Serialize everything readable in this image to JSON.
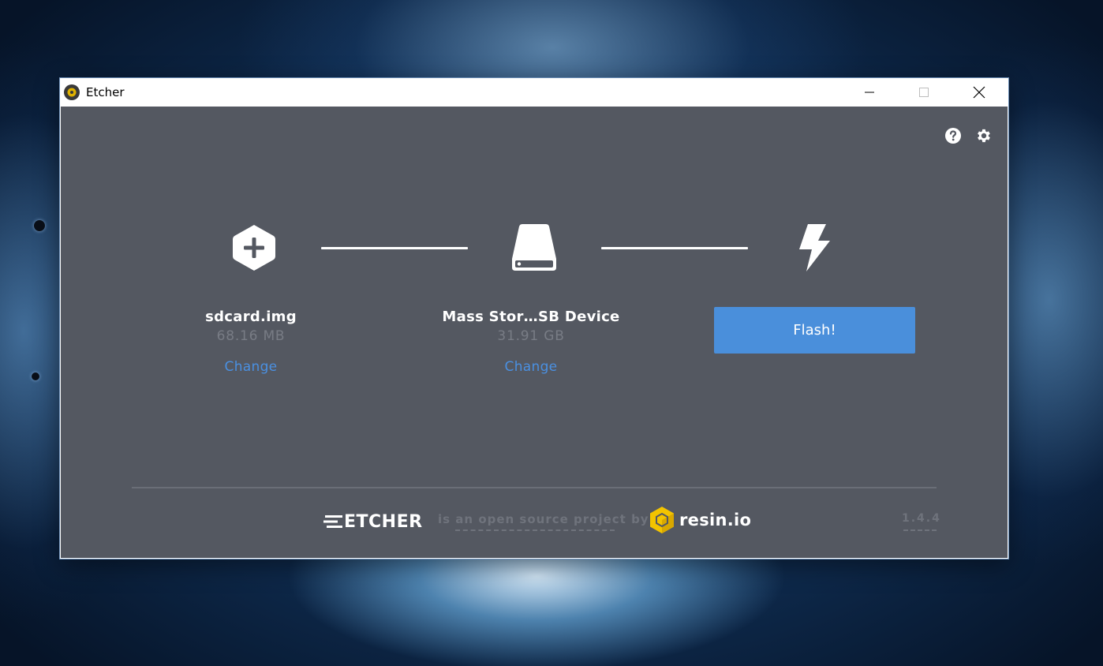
{
  "window": {
    "title": "Etcher"
  },
  "steps": {
    "image": {
      "icon": "plus-hexagon-icon",
      "name": "sdcard.img",
      "size": "68.16 MB",
      "change_label": "Change"
    },
    "drive": {
      "icon": "drive-icon",
      "name": "Mass Stor…SB Device",
      "size": "31.91 GB",
      "change_label": "Change"
    },
    "flash": {
      "icon": "lightning-icon",
      "button_label": "Flash!"
    }
  },
  "toolbar": {
    "help_icon": "help-icon",
    "settings_icon": "gear-icon"
  },
  "footer": {
    "logo_text": "ETCHER",
    "tagline": "is an open source project by",
    "company": "resin.io",
    "version": "1.4.4"
  },
  "colors": {
    "content_bg": "#545861",
    "accent": "#4a90e2",
    "flash_button": "#4a8fdb",
    "muted_text": "#787c85",
    "resin_yellow": "#f3c400"
  }
}
